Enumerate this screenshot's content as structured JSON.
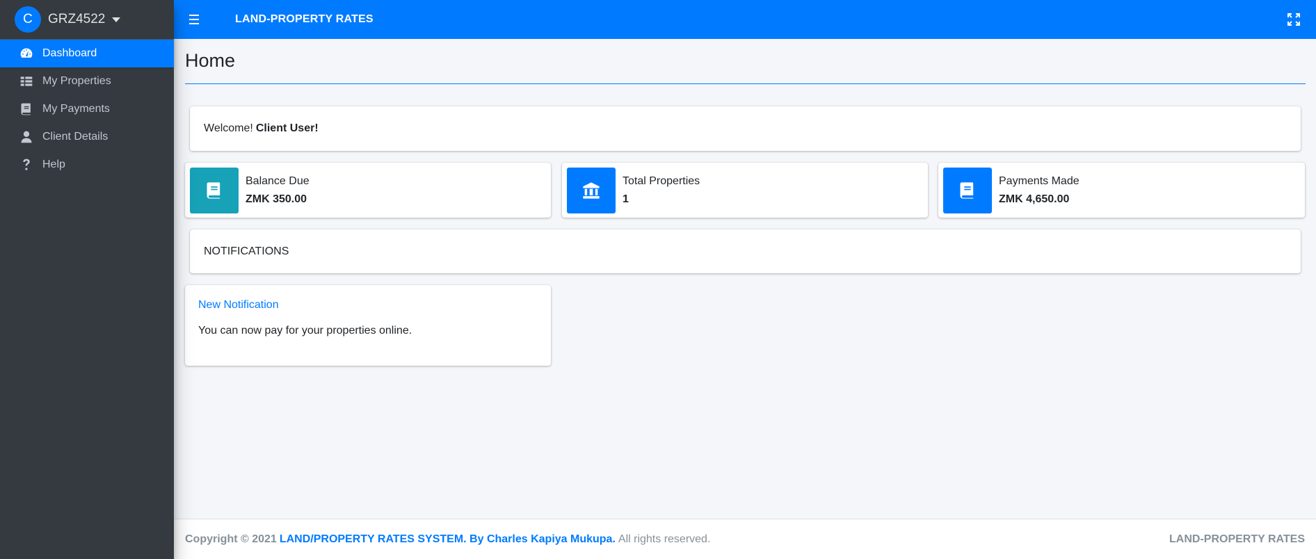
{
  "brand": {
    "avatar_letter": "C",
    "user_code": "GRZ4522"
  },
  "sidebar": {
    "items": [
      {
        "label": "Dashboard",
        "icon": "dashboard-icon",
        "active": true
      },
      {
        "label": "My Properties",
        "icon": "table-icon"
      },
      {
        "label": "My Payments",
        "icon": "book-icon"
      },
      {
        "label": "Client Details",
        "icon": "user-icon"
      },
      {
        "label": "Help",
        "icon": "question-icon"
      }
    ]
  },
  "topbar": {
    "title": "LAND-PROPERTY RATES"
  },
  "main": {
    "page_title": "Home",
    "welcome": {
      "prefix": "Welcome!",
      "name": "Client User!"
    },
    "info_boxes": [
      {
        "label": "Balance Due",
        "value": "ZMK 350.00",
        "icon": "book-icon",
        "color": "#17a2b8"
      },
      {
        "label": "Total Properties",
        "value": "1",
        "icon": "bank-icon",
        "color": "#007bff"
      },
      {
        "label": "Payments Made",
        "value": "ZMK 4,650.00",
        "icon": "book-icon",
        "color": "#007bff"
      }
    ],
    "notifications_header": "NOTIFICATIONS",
    "notification": {
      "title": "New Notification",
      "body": "You can now pay for your properties online."
    }
  },
  "footer": {
    "copyright": "Copyright © 2021",
    "link": "LAND/PROPERTY RATES SYSTEM. By Charles Kapiya Mukupa.",
    "rights": "All rights reserved.",
    "right_text": "LAND-PROPERTY RATES"
  },
  "colors": {
    "primary": "#007bff",
    "info": "#17a2b8",
    "sidebar": "#343a40"
  }
}
